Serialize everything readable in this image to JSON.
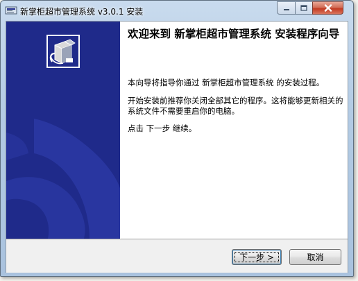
{
  "window": {
    "title": "新掌柜超市管理系统 v3.0.1 安装"
  },
  "icons": {
    "app": "installer-app-icon",
    "minimize": "minimize-icon",
    "maximize": "maximize-icon",
    "close": "close-icon",
    "wizard": "installer-box-icon"
  },
  "content": {
    "heading": "欢迎来到 新掌柜超市管理系统 安装程序向导",
    "paragraph1": "本向导将指导你通过 新掌柜超市管理系统 的安装过程。",
    "paragraph2": "开始安装前推荐你关闭全部其它的程序。这将能够更新相关的系统文件不需要重启你的电脑。",
    "paragraph3": "点击 下一步 继续。"
  },
  "buttons": {
    "next": "下一步 >",
    "cancel": "取消"
  },
  "colors": {
    "sidebar": "#1f2a8a",
    "titlebar": "#b9cfe7",
    "close_button": "#c7462e"
  }
}
